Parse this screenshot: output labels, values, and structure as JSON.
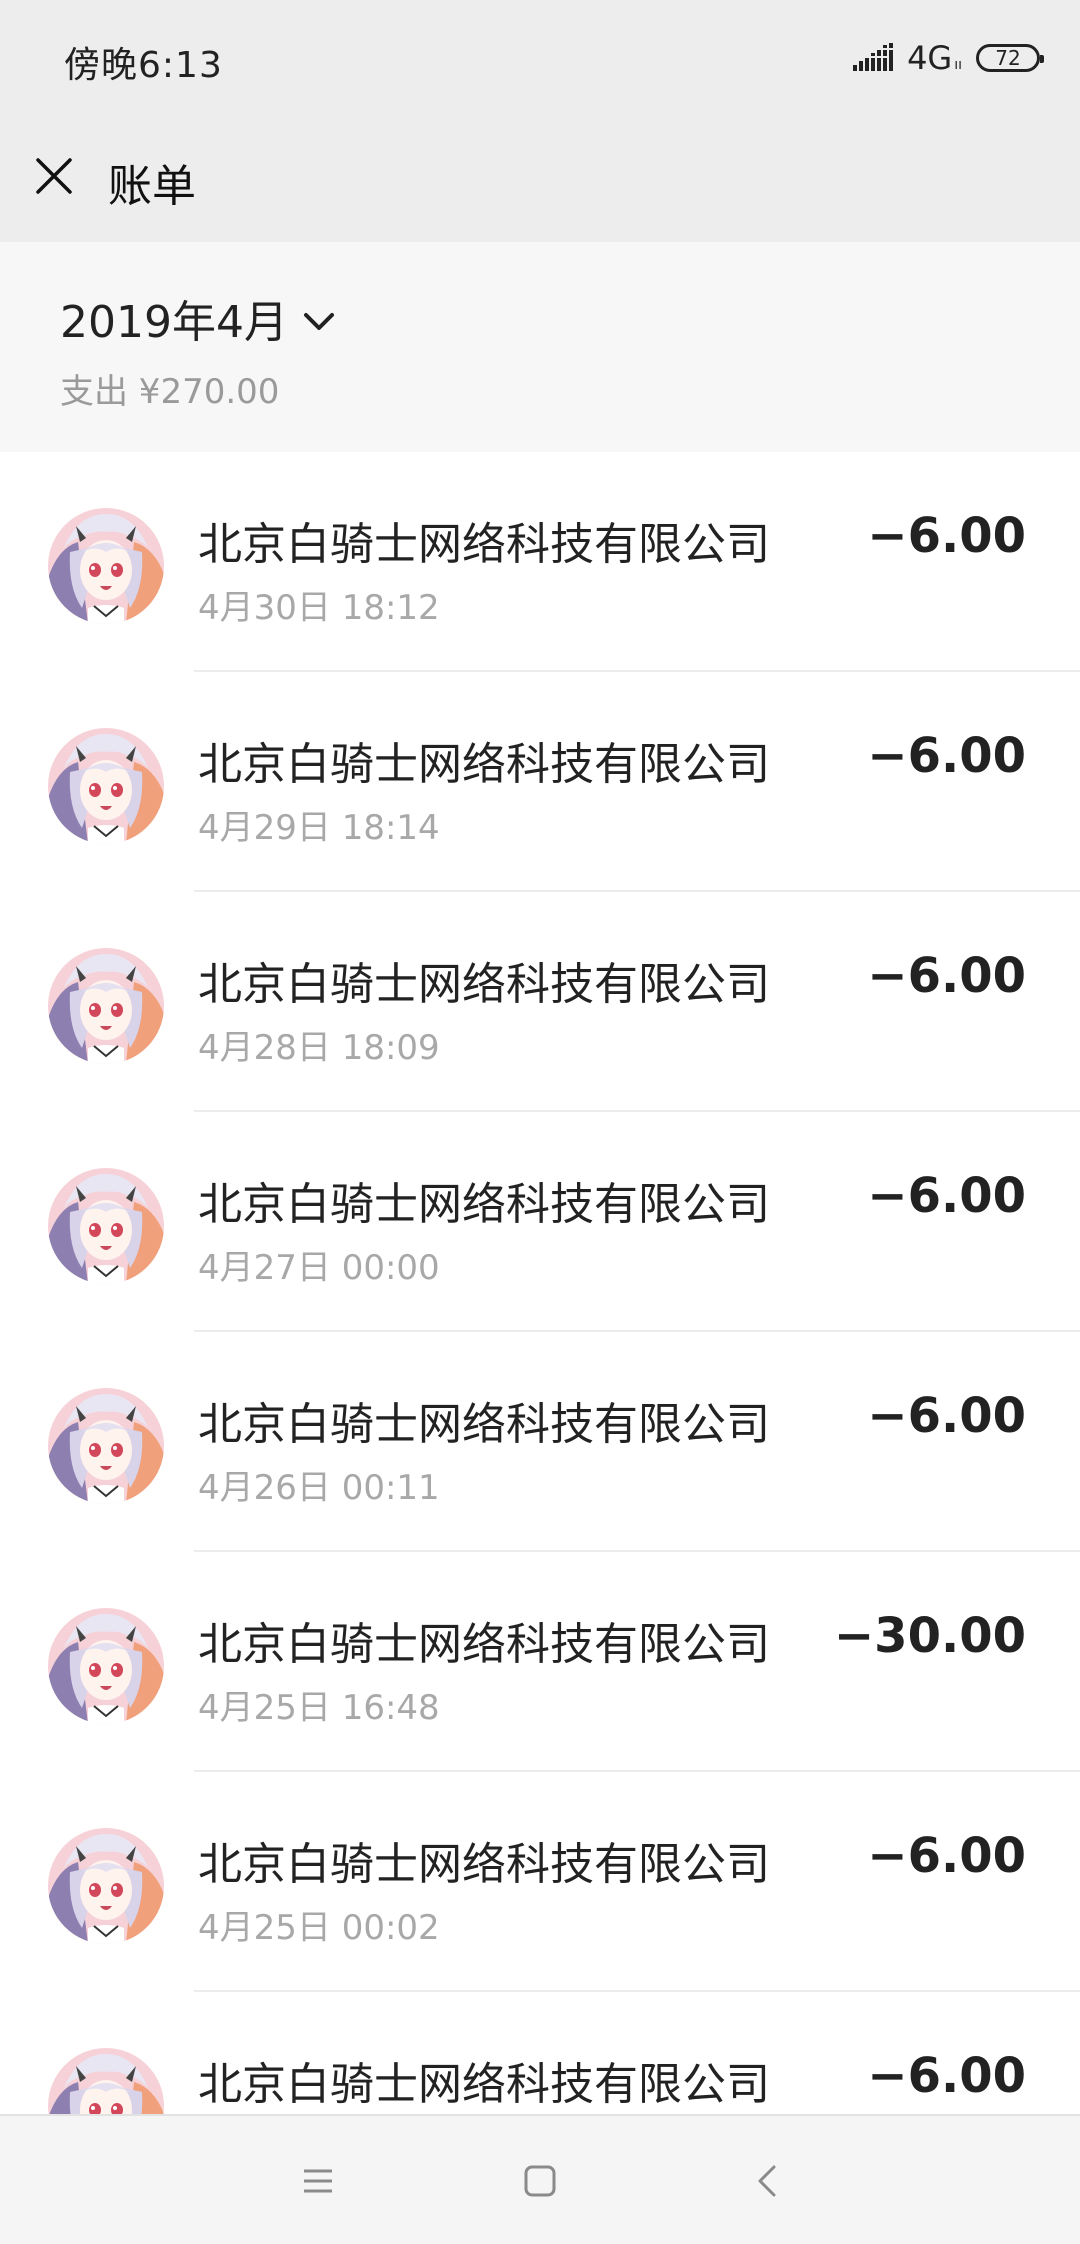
{
  "status_bar": {
    "time": "傍晚6:13",
    "network": "4G",
    "network_sub": "ıı",
    "battery": "72"
  },
  "header": {
    "title": "账单"
  },
  "summary": {
    "month": "2019年4月",
    "total": "支出 ¥270.00"
  },
  "transactions": [
    {
      "merchant": "北京白骑士网络科技有限公司",
      "time": "4月30日 18:12",
      "amount": "−6.00"
    },
    {
      "merchant": "北京白骑士网络科技有限公司",
      "time": "4月29日 18:14",
      "amount": "−6.00"
    },
    {
      "merchant": "北京白骑士网络科技有限公司",
      "time": "4月28日 18:09",
      "amount": "−6.00"
    },
    {
      "merchant": "北京白骑士网络科技有限公司",
      "time": "4月27日 00:00",
      "amount": "−6.00"
    },
    {
      "merchant": "北京白骑士网络科技有限公司",
      "time": "4月26日 00:11",
      "amount": "−6.00"
    },
    {
      "merchant": "北京白骑士网络科技有限公司",
      "time": "4月25日 16:48",
      "amount": "−30.00"
    },
    {
      "merchant": "北京白骑士网络科技有限公司",
      "time": "4月25日 00:02",
      "amount": "−6.00"
    },
    {
      "merchant": "北京白骑士网络科技有限公司",
      "time": "",
      "amount": "−6.00"
    }
  ],
  "icons": {
    "close": "close-icon",
    "dropdown": "chevron-down-icon",
    "nav_menu": "menu-icon",
    "nav_home": "home-icon",
    "nav_back": "back-icon",
    "avatar": "anime-girl-avatar"
  },
  "colors": {
    "header_bg": "#ededed",
    "summary_bg": "#f7f7f7",
    "primary_text": "#222222",
    "secondary_text": "#a8a8a8"
  }
}
